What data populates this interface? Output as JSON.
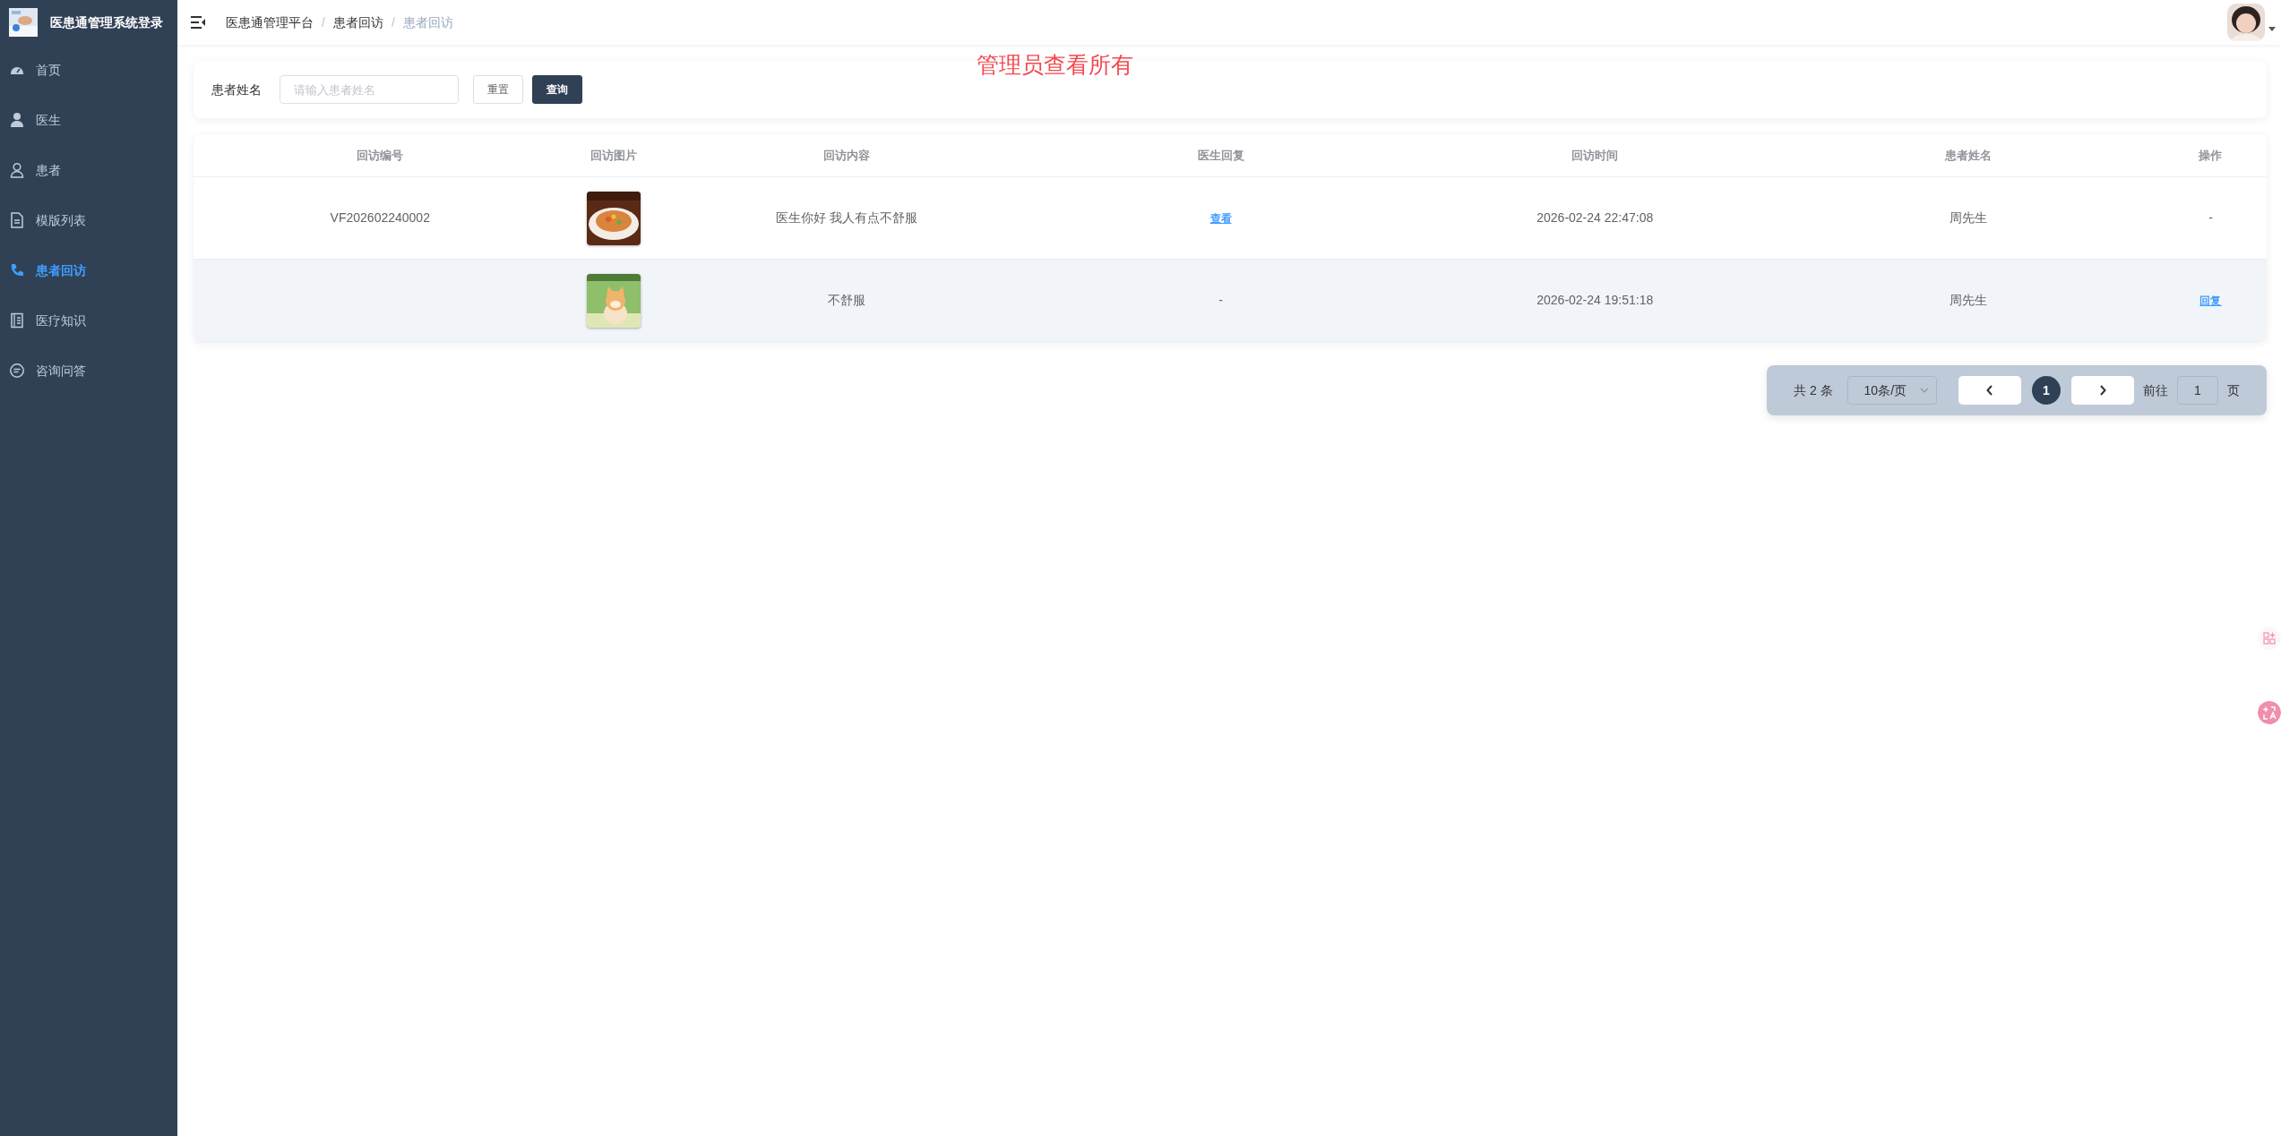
{
  "sidebar": {
    "title": "医患通管理系统登录",
    "items": [
      {
        "label": "首页",
        "selected": false
      },
      {
        "label": "医生",
        "selected": false
      },
      {
        "label": "患者",
        "selected": false
      },
      {
        "label": "模版列表",
        "selected": false
      },
      {
        "label": "患者回访",
        "selected": true
      },
      {
        "label": "医疗知识",
        "selected": false
      },
      {
        "label": "咨询问答",
        "selected": false
      }
    ]
  },
  "breadcrumb_separator": "/",
  "breadcrumb": [
    {
      "label": "医患通管理平台",
      "current": false
    },
    {
      "label": "患者回访",
      "current": false
    },
    {
      "label": "患者回访",
      "current": true
    }
  ],
  "annotation": "管理员查看所有",
  "search": {
    "label": "患者姓名",
    "placeholder": "请输入患者姓名",
    "buttons": [
      {
        "label": "重置",
        "kind": "default"
      },
      {
        "label": "查询",
        "kind": "primary"
      }
    ]
  },
  "table": {
    "columns": [
      "回访编号",
      "回访图片",
      "回访内容",
      "医生回复",
      "回访时间",
      "患者姓名",
      "操作"
    ],
    "rows": [
      {
        "highlighted": false,
        "cells": [
          {
            "kind": "text",
            "text": "VF202602240002"
          },
          {
            "kind": "picture"
          },
          {
            "kind": "text",
            "text": "医生你好 我人有点不舒服"
          },
          {
            "kind": "link",
            "text": "查看"
          },
          {
            "kind": "text",
            "text": "2026-02-24 22:47:08"
          },
          {
            "kind": "text",
            "text": "周先生"
          },
          {
            "kind": "text",
            "text": "-"
          }
        ]
      },
      {
        "highlighted": true,
        "cells": [
          {
            "kind": "empty"
          },
          {
            "kind": "picture"
          },
          {
            "kind": "text",
            "text": "不舒服"
          },
          {
            "kind": "text",
            "text": "-"
          },
          {
            "kind": "text",
            "text": "2026-02-24 19:51:18"
          },
          {
            "kind": "text",
            "text": "周先生"
          },
          {
            "kind": "link",
            "text": "回复"
          }
        ]
      }
    ]
  },
  "pagination": {
    "total": "共 2 条",
    "page_size": "10条/页",
    "pages": [
      {
        "label": "1",
        "selected": true
      }
    ],
    "goto_label": "前往",
    "goto_value": "1",
    "goto_suffix": "页"
  }
}
